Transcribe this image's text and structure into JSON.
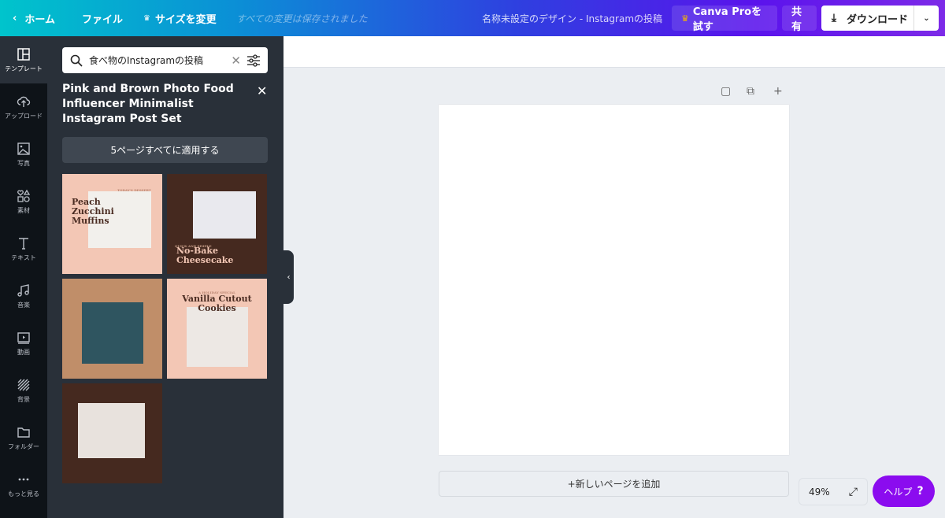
{
  "topbar": {
    "home": "ホーム",
    "file": "ファイル",
    "resize": "サイズを変更",
    "saved": "すべての変更は保存されました",
    "title": "名称未設定のデザイン - Instagramの投稿",
    "pro": "Canva Proを試す",
    "share": "共有",
    "download": "ダウンロード"
  },
  "rail": [
    {
      "label": "テンプレート",
      "icon": "template-icon"
    },
    {
      "label": "アップロード",
      "icon": "upload-icon"
    },
    {
      "label": "写真",
      "icon": "photo-icon"
    },
    {
      "label": "素材",
      "icon": "elements-icon"
    },
    {
      "label": "テキスト",
      "icon": "text-icon"
    },
    {
      "label": "音楽",
      "icon": "music-icon"
    },
    {
      "label": "動画",
      "icon": "video-icon"
    },
    {
      "label": "背景",
      "icon": "background-icon"
    },
    {
      "label": "フォルダー",
      "icon": "folder-icon"
    },
    {
      "label": "もっと見る",
      "icon": "more-icon"
    }
  ],
  "panel": {
    "search_value": "食べ物のInstagramの投稿",
    "title": "Pink and Brown Photo Food Influencer Minimalist Instagram Post Set",
    "apply": "5ページすべてに適用する",
    "templates": [
      {
        "title": "Peach Zucchini Muffins",
        "kicker": "TODAY'S DESSERT",
        "bg": "#f3c7b5"
      },
      {
        "title": "No-Bake Cheesecake",
        "kicker": "QUICK AND SIMPLE",
        "bg": "#45291f"
      },
      {
        "title": "",
        "kicker": "",
        "bg": "#c08e69"
      },
      {
        "title": "Vanilla Cutout Cookies",
        "kicker": "A HOLIDAY SPECIAL",
        "bg": "#f3c7b5"
      },
      {
        "title": "",
        "kicker": "",
        "bg": "#45291f"
      }
    ]
  },
  "canvas": {
    "add_page": "+新しいページを追加",
    "zoom": "49%",
    "help": "ヘルプ",
    "help_mark": "?"
  }
}
